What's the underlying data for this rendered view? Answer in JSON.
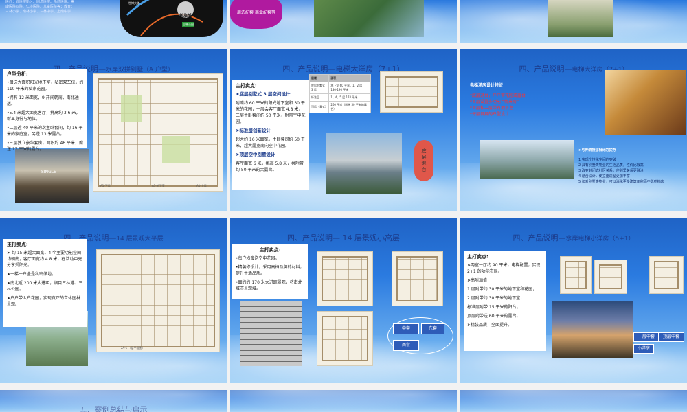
{
  "row0": {
    "s1_text": "医疗：省医院新区、同济医院、浙商医院、美康医院四院、仁济医院、儿童医院等；教育：三林小学、南林小学、三林中学、上南中学",
    "s1_map_label1": "世博大道",
    "s1_map_label2": "新旅城",
    "s1_map_label3": "三林公园",
    "s2_purple": "周边配套  商业配套等"
  },
  "s4": {
    "title": "四、产品说明—",
    "title_small": "水岸双拼别墅（A 户型）",
    "box_heading": "户型分析:",
    "box_lines": [
      "•赠送大面积阳光地下室，私密双车位，约 110 平米的私家花园。",
      "•拥有 12 米面宽，9 开间朝南，南北通透。",
      "•5.4 米超大面宽客厅，挑高约 3.6 米，彰显身份与地位。",
      "•二层近 40 平米的次主卧套间，约 16 平米的家庭室，另送 13 米露台。",
      "•三层独立豪华套房，面积约 46 平米，赠送 17 平米的露台。"
    ],
    "plan_caption1": "A1-下层",
    "plan_caption2": "A1-地下室",
    "plan_caption3": "A1-上层"
  },
  "s5": {
    "title": "四、产品说明—电梯大洋房（7+1）",
    "box_heading": "主打卖点:",
    "items": [
      {
        "h": "➤底层别墅式 3 层空间设计",
        "t": "附赠约 60 平米的阳光地下室和 30 平米的花园，一层会客厅面宽 4.8 米，二层主卧套间约 50 平米，附带空中花园。"
      },
      {
        "h": "➤标准层创新设计",
        "t": "超大约 16 米面宽，主卧套间约 50 平米，超大露宽南向空中花园。"
      },
      {
        "h": "➤顶层空中别墅设计",
        "t": "客厅面宽 6 米，挑高 5.8 米，共附带约 50 平米的大露台。"
      }
    ],
    "table": [
      [
        "层楼",
        "面积"
      ],
      [
        "底层别墅式 3 层",
        "地下室 60 平米，1、2 层 180-190 平米"
      ],
      [
        "标准层",
        "1、4、5 层 170 平米"
      ],
      [
        "顶层（复式）",
        "260 平米（附带 50 平米的露台）"
      ]
    ],
    "red_label": "底层退台"
  },
  "s6": {
    "title": "四、产品说明—",
    "title_small": "电梯大洋房（7+1）",
    "heading": "电梯洋房设计特征",
    "red_lines": [
      "*底层退台，户户带花园或露台",
      "*首层设置多功能 “情景房”",
      "*首层和二层带有地下室",
      "*每层各异的户型设计"
    ],
    "compare_heading": "➤与传统物业相比的优势",
    "compare_lines": [
      "1  实现个性化空间的突破",
      "2  具有别墅类物业的生活品质，性价比极高",
      "3  改变封闭式社区关系，使邻里关系更融洽",
      "4  退台设计，使立面造型更加丰富",
      "5  和对别墅类物业，可以消化更多建筑面积而不影响档次"
    ]
  },
  "s7": {
    "title": "四、产品说明—",
    "title_small": "14 层景观大平层",
    "box_heading": "主打卖点:",
    "box_lines": [
      "➤ 约 15 米超大面宽，4 个主要功能空间均朝南，客厅面宽约 4.8 米，在活动中充分享受阳光。",
      "➤一梯一户全是私密储地。",
      "➤南北近 200 米大进距，临目三林港、三林公园。",
      "➤户户带入户花园，实现真正的立体园林景观。"
    ],
    "plan_caption": "2A-1 （层平面图）"
  },
  "s8": {
    "title": "四、产品说明— 14 层景观小高层",
    "box_heading": "主打卖点:",
    "box_lines": [
      "•每户均赠送空中花园。",
      "•精装修设计，采用高档品牌的材料，提升生活品质。",
      "•面约约 170 米大进距景观，将南北城市景观域。"
    ],
    "tags": [
      "中套",
      "东套",
      "西套"
    ]
  },
  "s9": {
    "title": "四、产品说明—",
    "title_small": "水岸电梯小洋房（5+1）",
    "box_heading": "主打卖点:",
    "box_lines": [
      "➤两室一厅约 90 平米，电梯配置，实现 2+1 的功能布局。",
      "➤高附加值：",
      "1 层附带约 30 平米的地下室和花园；",
      "2 层附带约 30 平米的地下室；",
      "标准层附带 15 平米的阳台；",
      "顶层附带送 60 平米的露台。",
      "➤精装品质，全面提升。"
    ],
    "tags": [
      "一层中套",
      "顶层中套",
      "小洋房"
    ]
  },
  "row3": {
    "s10_title": "五、案例总结与启示"
  }
}
